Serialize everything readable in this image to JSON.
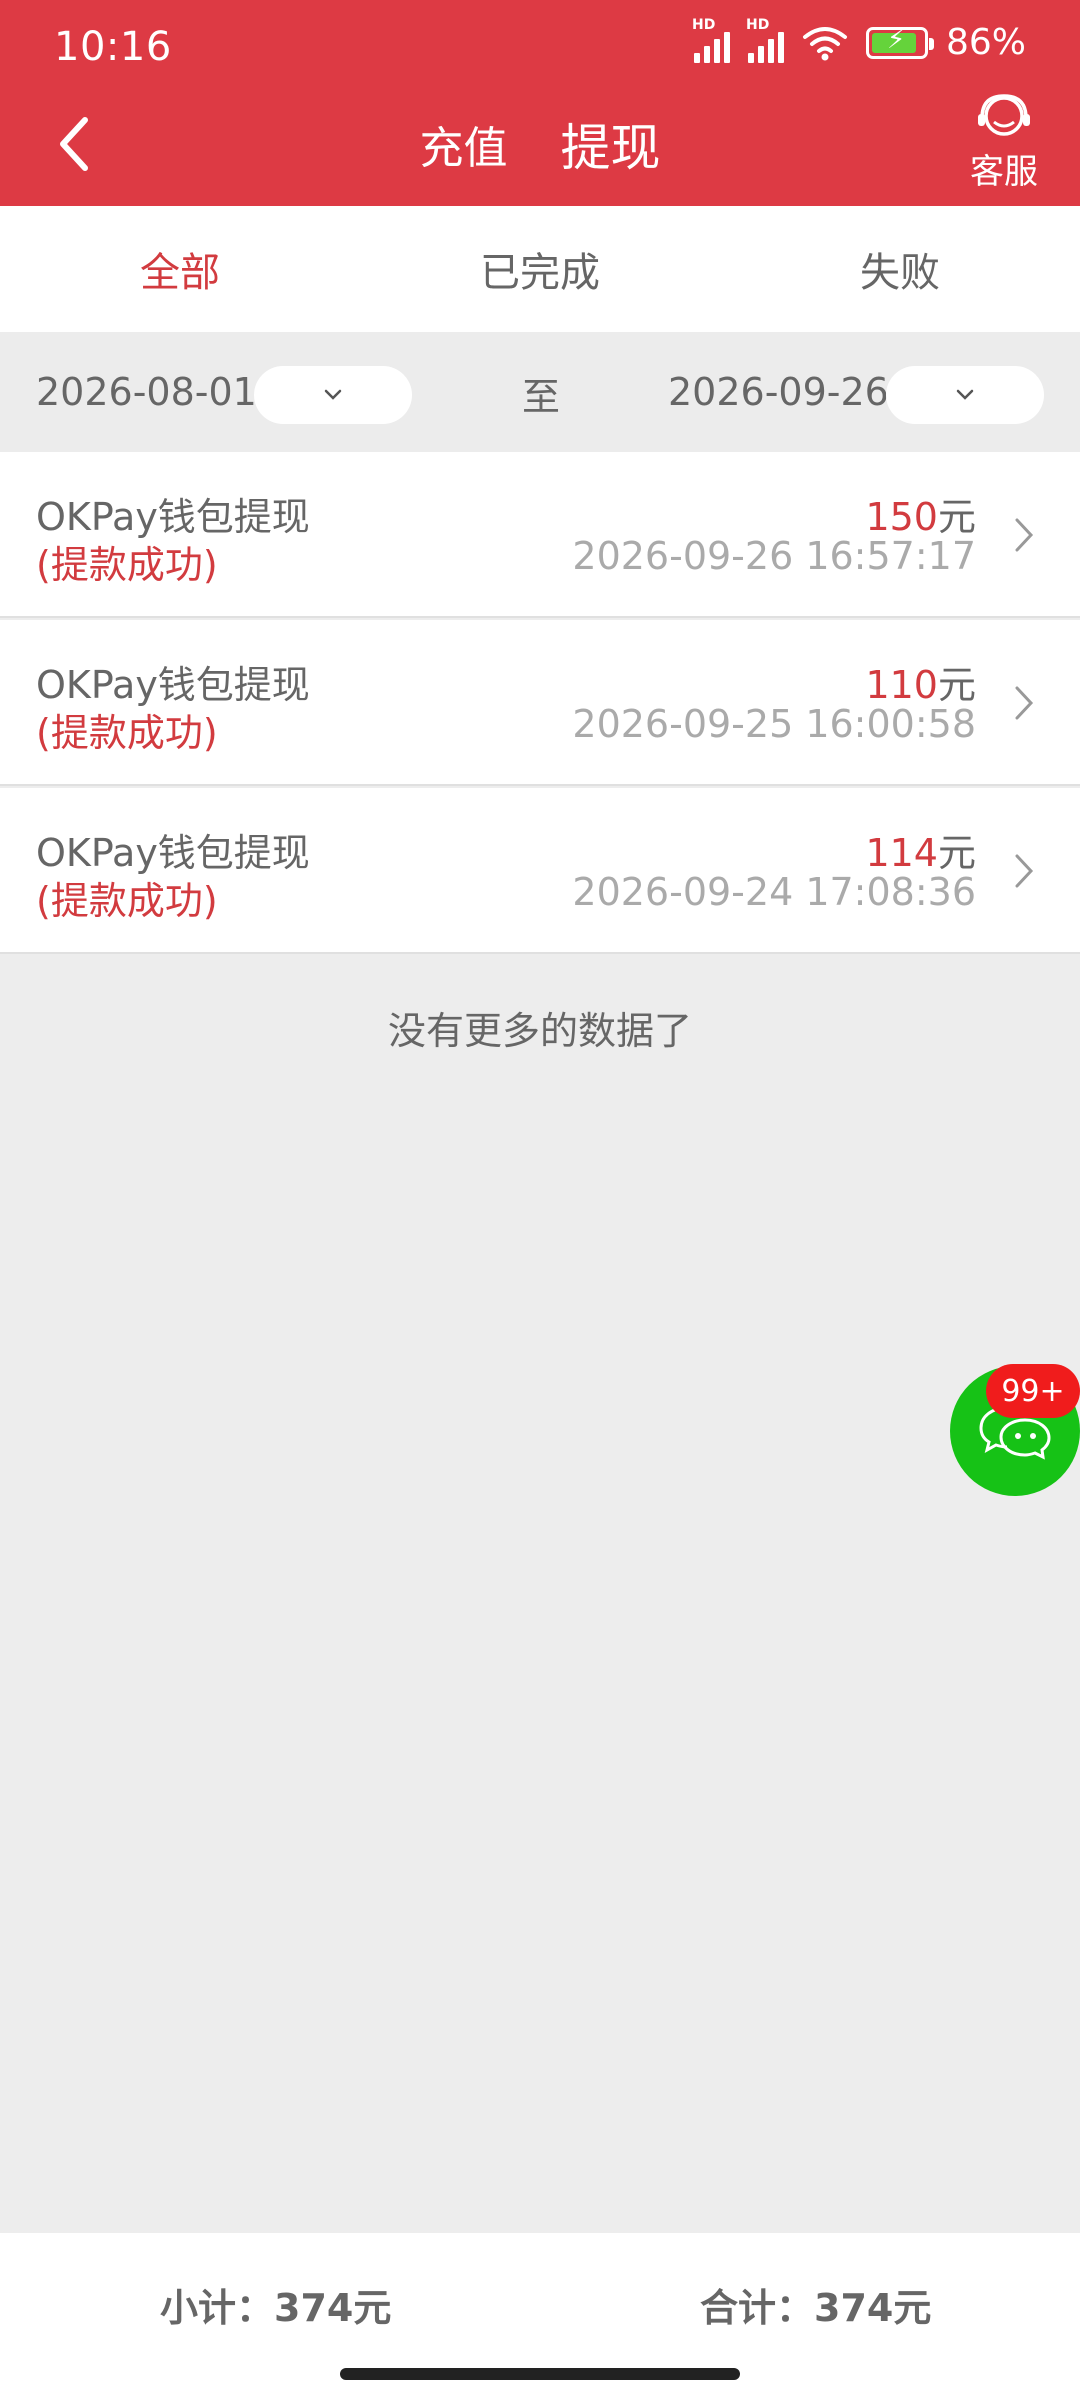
{
  "status_bar": {
    "time": "10:16",
    "battery": "86%",
    "signal_1_label": "HD",
    "signal_2_label": "HD"
  },
  "header": {
    "tabs": [
      "充值",
      "提现"
    ],
    "active_tab": "提现",
    "customer_service": "客服"
  },
  "filter_tabs": {
    "items": [
      "全部",
      "已完成",
      "失败"
    ],
    "active": "全部"
  },
  "date_range": {
    "start": "2026-08-01",
    "separator": "至",
    "end": "2026-09-26"
  },
  "records": [
    {
      "title": "OKPay钱包提现",
      "status": "(提款成功)",
      "amount": "150",
      "unit": "元",
      "time": "2026-09-26 16:57:17"
    },
    {
      "title": "OKPay钱包提现",
      "status": "(提款成功)",
      "amount": "110",
      "unit": "元",
      "time": "2026-09-25 16:00:58"
    },
    {
      "title": "OKPay钱包提现",
      "status": "(提款成功)",
      "amount": "114",
      "unit": "元",
      "time": "2026-09-24 17:08:36"
    }
  ],
  "no_more_text": "没有更多的数据了",
  "chat": {
    "badge": "99+"
  },
  "footer": {
    "subtotal": "小计：374元",
    "total": "合计：374元"
  },
  "colors": {
    "header_bg": "#dd3a44",
    "accent_red": "#d23b3f",
    "chat_green": "#16c216",
    "badge_red": "#f01c1c"
  }
}
